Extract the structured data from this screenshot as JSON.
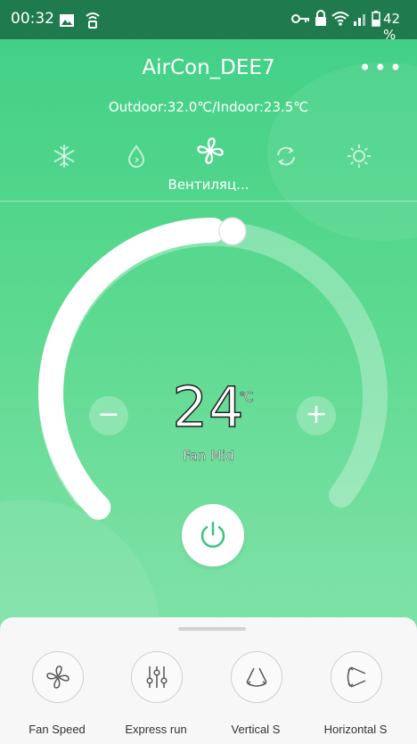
{
  "status_bar": {
    "time": "00:32",
    "battery": "42 %",
    "icons": [
      "image-icon",
      "wifi-call-icon",
      "key-icon",
      "lock-icon",
      "wifi-icon",
      "signal-icon",
      "battery-icon"
    ]
  },
  "header": {
    "title": "AirCon_DEE7",
    "more_icon": "more-dots-icon",
    "temps": "Outdoor:32.0℃/Indoor:23.5℃"
  },
  "modes": {
    "items": [
      "snowflake-icon",
      "water-drop-icon",
      "fan-icon",
      "auto-cycle-icon",
      "sun-icon"
    ],
    "selected_label": "Вентиляц..."
  },
  "thermostat": {
    "temperature": "24",
    "unit": "℃",
    "fan_label": "Fan Mid",
    "minus": "−",
    "plus": "+",
    "level": 0.5
  },
  "functions": [
    {
      "label": "Fan Speed",
      "icon": "fan-icon"
    },
    {
      "label": "Express run",
      "icon": "sliders-icon"
    },
    {
      "label": "Vertical S",
      "icon": "vertical-swing-icon"
    },
    {
      "label": "Horizontal S",
      "icon": "horizontal-swing-icon"
    }
  ],
  "colors": {
    "status_bar": "#1f7a4e",
    "gradient_top": "#3fcf85",
    "gradient_bottom": "#86e4ac",
    "power_icon": "#3cc47f"
  }
}
